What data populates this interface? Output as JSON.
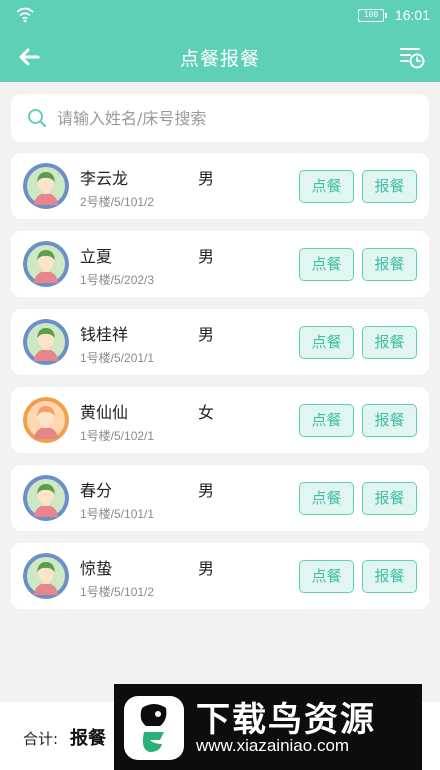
{
  "status_bar": {
    "battery": "100",
    "time": "16:01"
  },
  "header": {
    "title": "点餐报餐",
    "back_icon": "arrow-left-icon",
    "history_icon": "list-clock-icon"
  },
  "search": {
    "placeholder": "请输入姓名/床号搜索",
    "value": ""
  },
  "patients": [
    {
      "name": "李云龙",
      "gender": "男",
      "bed": "2号楼/5/101/2",
      "avatar": "male",
      "order_label": "点餐",
      "report_label": "报餐"
    },
    {
      "name": "立夏",
      "gender": "男",
      "bed": "1号楼/5/202/3",
      "avatar": "male",
      "order_label": "点餐",
      "report_label": "报餐"
    },
    {
      "name": "钱桂祥",
      "gender": "男",
      "bed": "1号楼/5/201/1",
      "avatar": "male",
      "order_label": "点餐",
      "report_label": "报餐"
    },
    {
      "name": "黄仙仙",
      "gender": "女",
      "bed": "1号楼/5/102/1",
      "avatar": "female",
      "order_label": "点餐",
      "report_label": "报餐"
    },
    {
      "name": "春分",
      "gender": "男",
      "bed": "1号楼/5/101/1",
      "avatar": "male",
      "order_label": "点餐",
      "report_label": "报餐"
    },
    {
      "name": "惊蛰",
      "gender": "男",
      "bed": "1号楼/5/101/2",
      "avatar": "male",
      "order_label": "点餐",
      "report_label": "报餐"
    }
  ],
  "footer": {
    "total_label": "合计:",
    "total_value": "报餐"
  },
  "watermark": {
    "title": "下载鸟资源",
    "url": "www.xiazainiao.com"
  },
  "colors": {
    "primary": "#5fd0b8",
    "button_bg": "#e2f6f1",
    "male_ring": "#6b8fc9",
    "female_ring": "#f0a04b"
  }
}
